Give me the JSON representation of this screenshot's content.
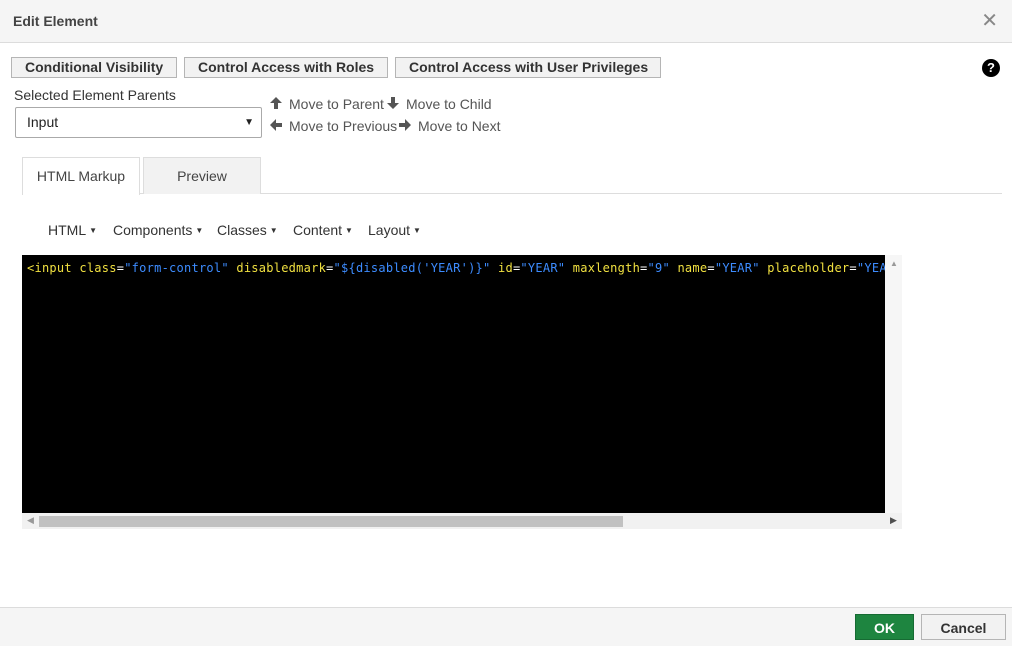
{
  "dialog": {
    "title": "Edit Element",
    "close_icon": "close-icon"
  },
  "toolbar": {
    "conditional_visibility": "Conditional Visibility",
    "control_roles": "Control Access with Roles",
    "control_privileges": "Control Access with User Privileges",
    "help_icon": "help-icon",
    "help_glyph": "?"
  },
  "parents": {
    "label": "Selected Element Parents",
    "selected": "Input",
    "move_parent": "Move to Parent",
    "move_child": "Move to Child",
    "move_previous": "Move to Previous",
    "move_next": "Move to Next"
  },
  "tabs": {
    "html_markup": "HTML Markup",
    "preview": "Preview",
    "active": "HTML Markup"
  },
  "editor_menu": {
    "html": "HTML",
    "components": "Components",
    "classes": "Classes",
    "content": "Content",
    "layout": "Layout"
  },
  "code": {
    "tag": "<input",
    "attrs": [
      {
        "name": "class",
        "value": "\"form-control\""
      },
      {
        "name": "disabledmark",
        "value": "\"${disabled('YEAR')}\""
      },
      {
        "name": "id",
        "value": "\"YEAR\""
      },
      {
        "name": "maxlength",
        "value": "\"9\""
      },
      {
        "name": "name",
        "value": "\"YEAR\""
      },
      {
        "name": "placeholder",
        "value": "\"YEAR\""
      }
    ],
    "colors": {
      "tag": "#f0e040",
      "attribute": "#f0e040",
      "string": "#3d8cff",
      "background": "#000000"
    }
  },
  "footer": {
    "ok": "OK",
    "cancel": "Cancel",
    "ok_color": "#1e8540"
  }
}
